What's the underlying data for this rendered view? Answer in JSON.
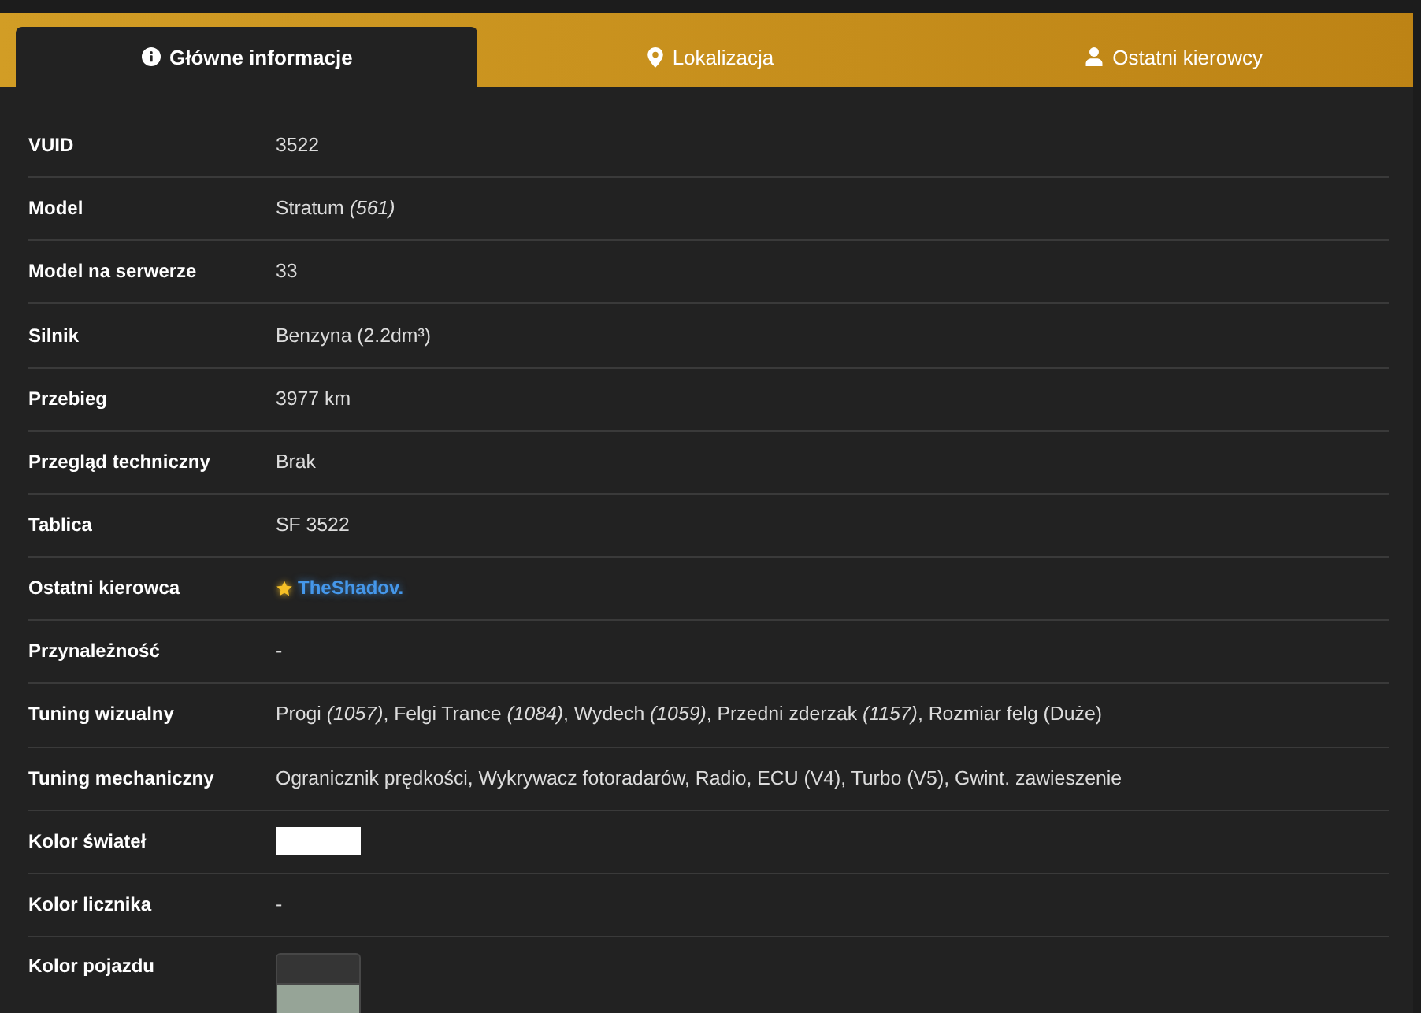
{
  "tabs": [
    {
      "label": "Główne informacje",
      "selected": true
    },
    {
      "label": "Lokalizacja",
      "selected": false
    },
    {
      "label": "Ostatni kierowcy",
      "selected": false
    }
  ],
  "rows": [
    {
      "label": "VUID",
      "kind": "text",
      "value": "3522"
    },
    {
      "label": "Model",
      "kind": "text",
      "value": "Stratum *(561)*"
    },
    {
      "label": "Model na serwerze",
      "kind": "text",
      "value": "33"
    },
    {
      "label": "Silnik",
      "kind": "text",
      "value": "Benzyna (2.2dm³)"
    },
    {
      "label": "Przebieg",
      "kind": "text",
      "value": "3977 km"
    },
    {
      "label": "Przegląd techniczny",
      "kind": "text",
      "value": "Brak"
    },
    {
      "label": "Tablica",
      "kind": "text",
      "value": "SF 3522"
    },
    {
      "label": "Ostatni kierowca",
      "kind": "driver",
      "value": "TheShadov."
    },
    {
      "label": "Przynależność",
      "kind": "text",
      "value": "-"
    },
    {
      "label": "Tuning wizualny",
      "kind": "text",
      "value": "Progi *(1057)*, Felgi Trance *(1084)*, Wydech *(1059)*, Przedni zderzak *(1157)*, Rozmiar felg (Duże)"
    },
    {
      "label": "Tuning mechaniczny",
      "kind": "text",
      "value": "Ogranicznik prędkości, Wykrywacz fotoradarów, Radio, ECU (V4), Turbo (V5), Gwint. zawieszenie"
    },
    {
      "label": "Kolor świateł",
      "kind": "swatch",
      "color": "#ffffff"
    },
    {
      "label": "Kolor licznika",
      "kind": "text",
      "value": "-"
    },
    {
      "label": "Kolor pojazdu",
      "kind": "swatch_pair",
      "swatches": [
        {
          "color": "#353535"
        },
        {
          "color": "#96a497"
        }
      ]
    }
  ]
}
